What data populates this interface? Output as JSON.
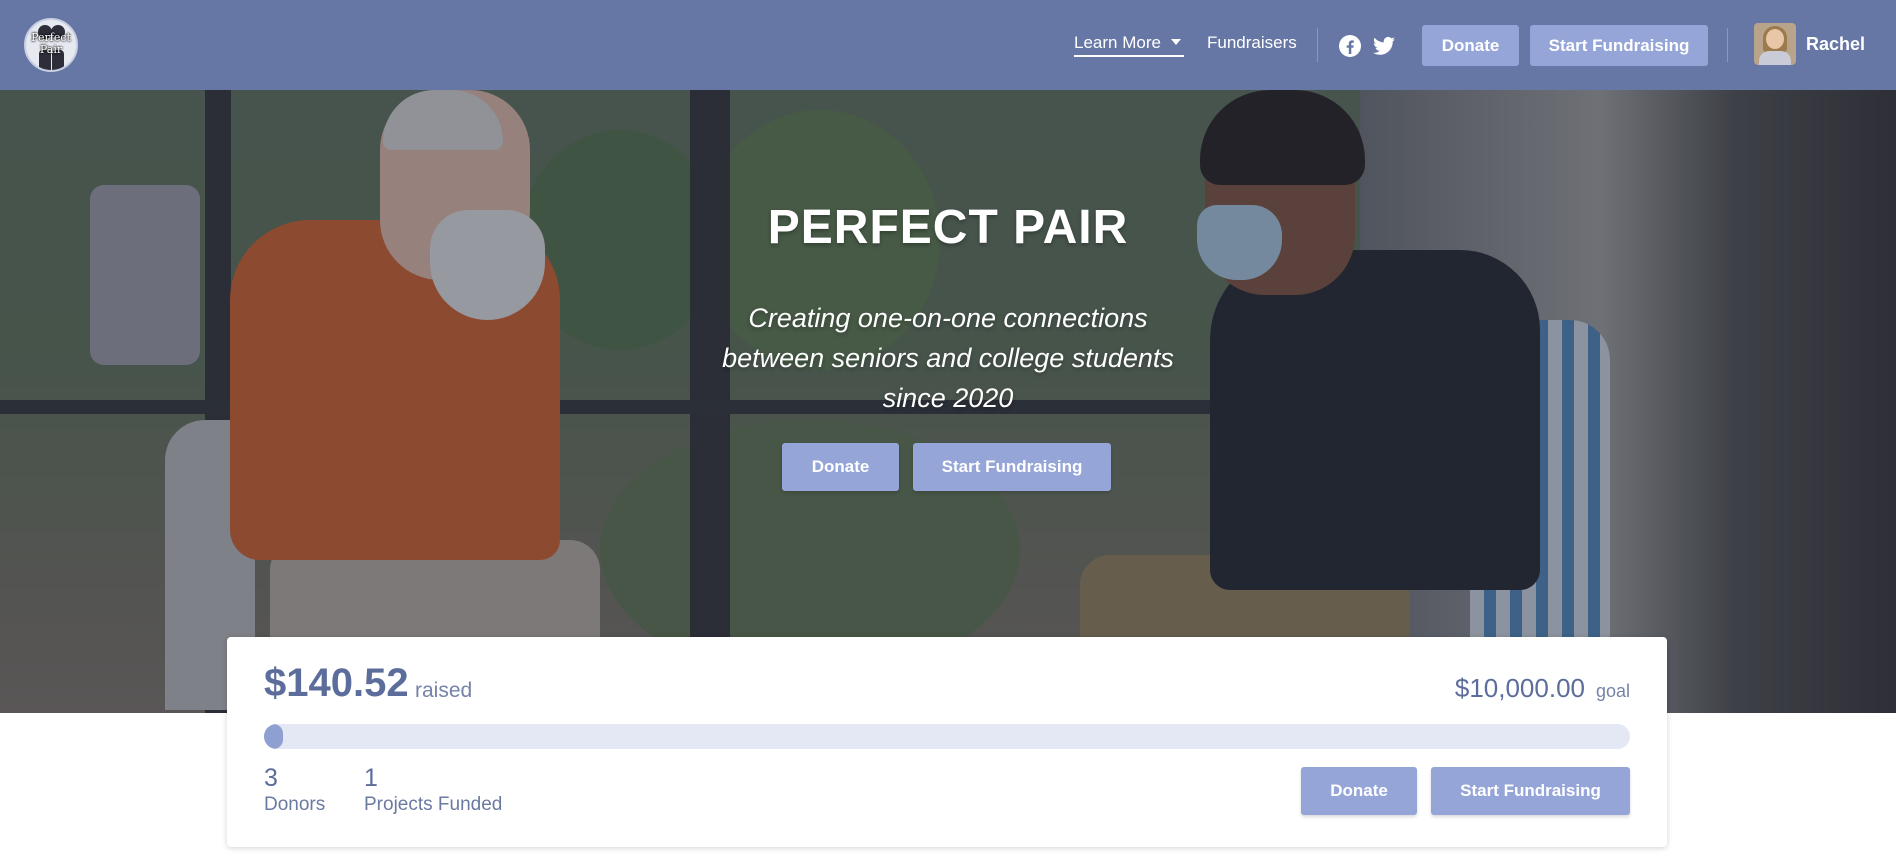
{
  "header": {
    "logo_text": "Perfect Pair",
    "nav": {
      "learn_more": "Learn More",
      "fundraisers": "Fundraisers"
    },
    "social": [
      "facebook-icon",
      "twitter-icon"
    ],
    "donate_label": "Donate",
    "start_label": "Start Fundraising",
    "user_name": "Rachel"
  },
  "hero": {
    "title": "PERFECT PAIR",
    "subtitle": "Creating one-on-one connections between seniors and college students since 2020",
    "donate_label": "Donate",
    "start_label": "Start Fundraising"
  },
  "progress": {
    "raised": "$140.52",
    "raised_label": "raised",
    "goal": "$10,000.00",
    "goal_label": "goal",
    "fraction": 0.014,
    "donors_count": "3",
    "donors_label": "Donors",
    "projects_count": "1",
    "projects_label": "Projects Funded",
    "donate_label": "Donate",
    "start_label": "Start Fundraising"
  },
  "colors": {
    "header_bg": "#6677a5",
    "button_bg": "#95a5d7",
    "progress_fill": "#8e9fd2",
    "progress_track": "#e3e8f4",
    "text_accent": "#5d6d9b"
  }
}
